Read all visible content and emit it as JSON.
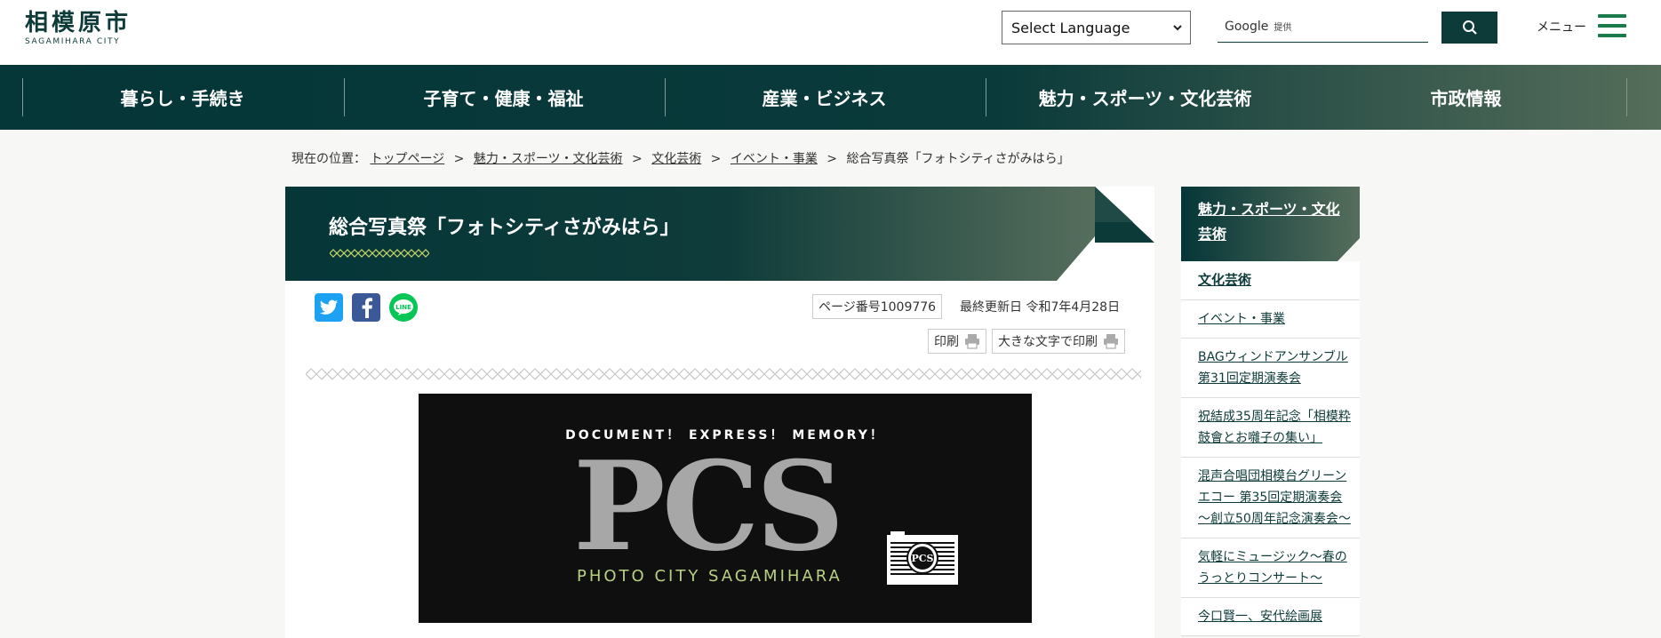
{
  "header": {
    "logo_jp": "相模原市",
    "logo_en": "SAGAMIHARA CITY",
    "language_select": "Select Language",
    "search_google": "Google",
    "search_teikyo": "提供",
    "menu_label": "メニュー"
  },
  "gnav": {
    "items": [
      {
        "label": "暮らし・手続き"
      },
      {
        "label": "子育て・健康・福祉"
      },
      {
        "label": "産業・ビジネス"
      },
      {
        "label": "魅力・スポーツ・文化芸術"
      },
      {
        "label": "市政情報"
      }
    ]
  },
  "breadcrumb": {
    "prefix": "現在の位置：",
    "items": [
      {
        "label": "トップページ"
      },
      {
        "label": "魅力・スポーツ・文化芸術"
      },
      {
        "label": "文化芸術"
      },
      {
        "label": "イベント・事業"
      }
    ],
    "current": "総合写真祭「フォトシティさがみはら」",
    "separator": ">"
  },
  "main": {
    "title": "総合写真祭「フォトシティさがみはら」",
    "page_number": "ページ番号1009776",
    "updated": "最終更新日 令和7年4月28日",
    "print": "印刷",
    "print_large": "大きな文字で印刷",
    "banner": {
      "tagline": "DOCUMENT！ EXPRESS！ MEMORY！",
      "big": "PCS",
      "sub": "PHOTO CITY SAGAMIHARA"
    }
  },
  "sidebar": {
    "heading": "魅力・スポーツ・文化芸術",
    "items": [
      {
        "label": "文化芸術"
      },
      {
        "label": "イベント・事業"
      },
      {
        "label": "BAGウィンドアンサンブル 第31回定期演奏会"
      },
      {
        "label": "祝結成35周年記念「相模粋鼓會とお囃子の集い」"
      },
      {
        "label": "混声合唱団相模台グリーンエコー 第35回定期演奏会～創立50周年記念演奏会～"
      },
      {
        "label": "気軽にミュージック～春のうっとりコンサート～"
      },
      {
        "label": "今口賢一、安代絵画展"
      }
    ]
  },
  "colors": {
    "primary": "#0d3b3a",
    "accent_green": "#1a7a4a",
    "twitter": "#1da1f2",
    "facebook": "#3b5998",
    "line": "#06c755"
  }
}
